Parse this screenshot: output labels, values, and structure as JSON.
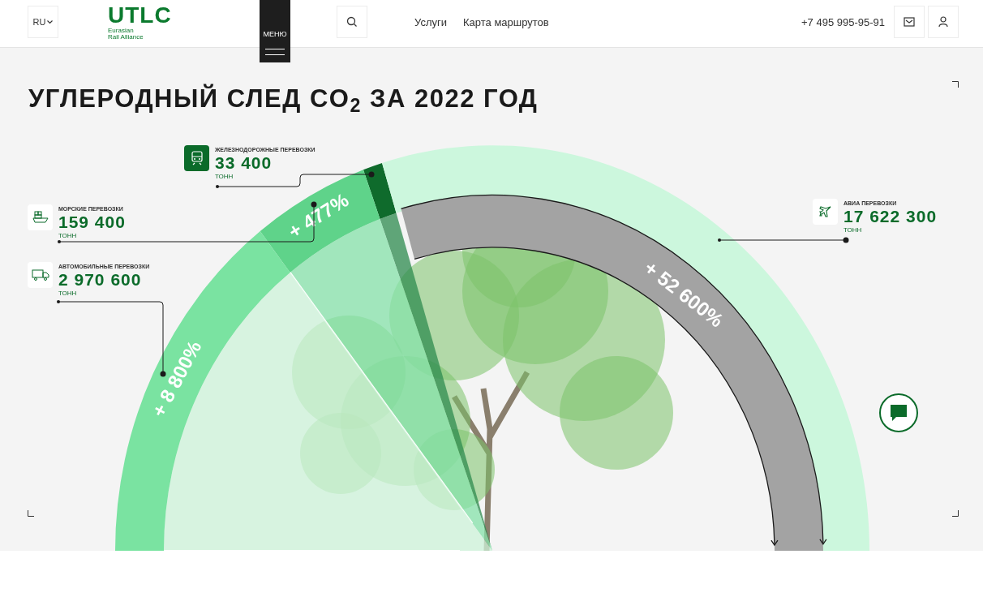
{
  "header": {
    "language": "RU",
    "logo": {
      "mark": "UTLC",
      "subtitle_1": "Eurasian",
      "subtitle_2": "Rail Alliance"
    },
    "menu_button": "МЕНЮ",
    "nav": [
      "Услуги",
      "Карта маршрутов"
    ],
    "phone": "+7 495 995-95-91"
  },
  "title": "УГЛЕРОДНЫЙ СЛЕД CO$_{2}$ ЗА 2022 ГОД",
  "transport": [
    {
      "kind": "rail",
      "label": "ЖЕЛЕЗНОДОРОЖНЫЕ ПЕРЕВОЗКИ",
      "value": "33 400",
      "unit": "ТОНН",
      "selected": true,
      "color": "#0f6b2c"
    },
    {
      "kind": "sea",
      "label": "МОРСКИЕ ПЕРЕВОЗКИ",
      "value": "159 400",
      "unit": "ТОНН",
      "selected": false,
      "color": "#5fd38a",
      "percent": "+ 477%"
    },
    {
      "kind": "road",
      "label": "АВТОМОБИЛЬНЫЕ ПЕРЕВОЗКИ",
      "value": "2 970 600",
      "unit": "ТОНН",
      "selected": false,
      "color": "#7ae3a1",
      "percent": "+ 8 800%"
    },
    {
      "kind": "air",
      "label": "АВИА ПЕРЕВОЗКИ",
      "value": "17 622 300",
      "unit": "ТОНН",
      "selected": false,
      "color": "#ccf7dd",
      "percent": "+ 52 600%"
    }
  ]
}
